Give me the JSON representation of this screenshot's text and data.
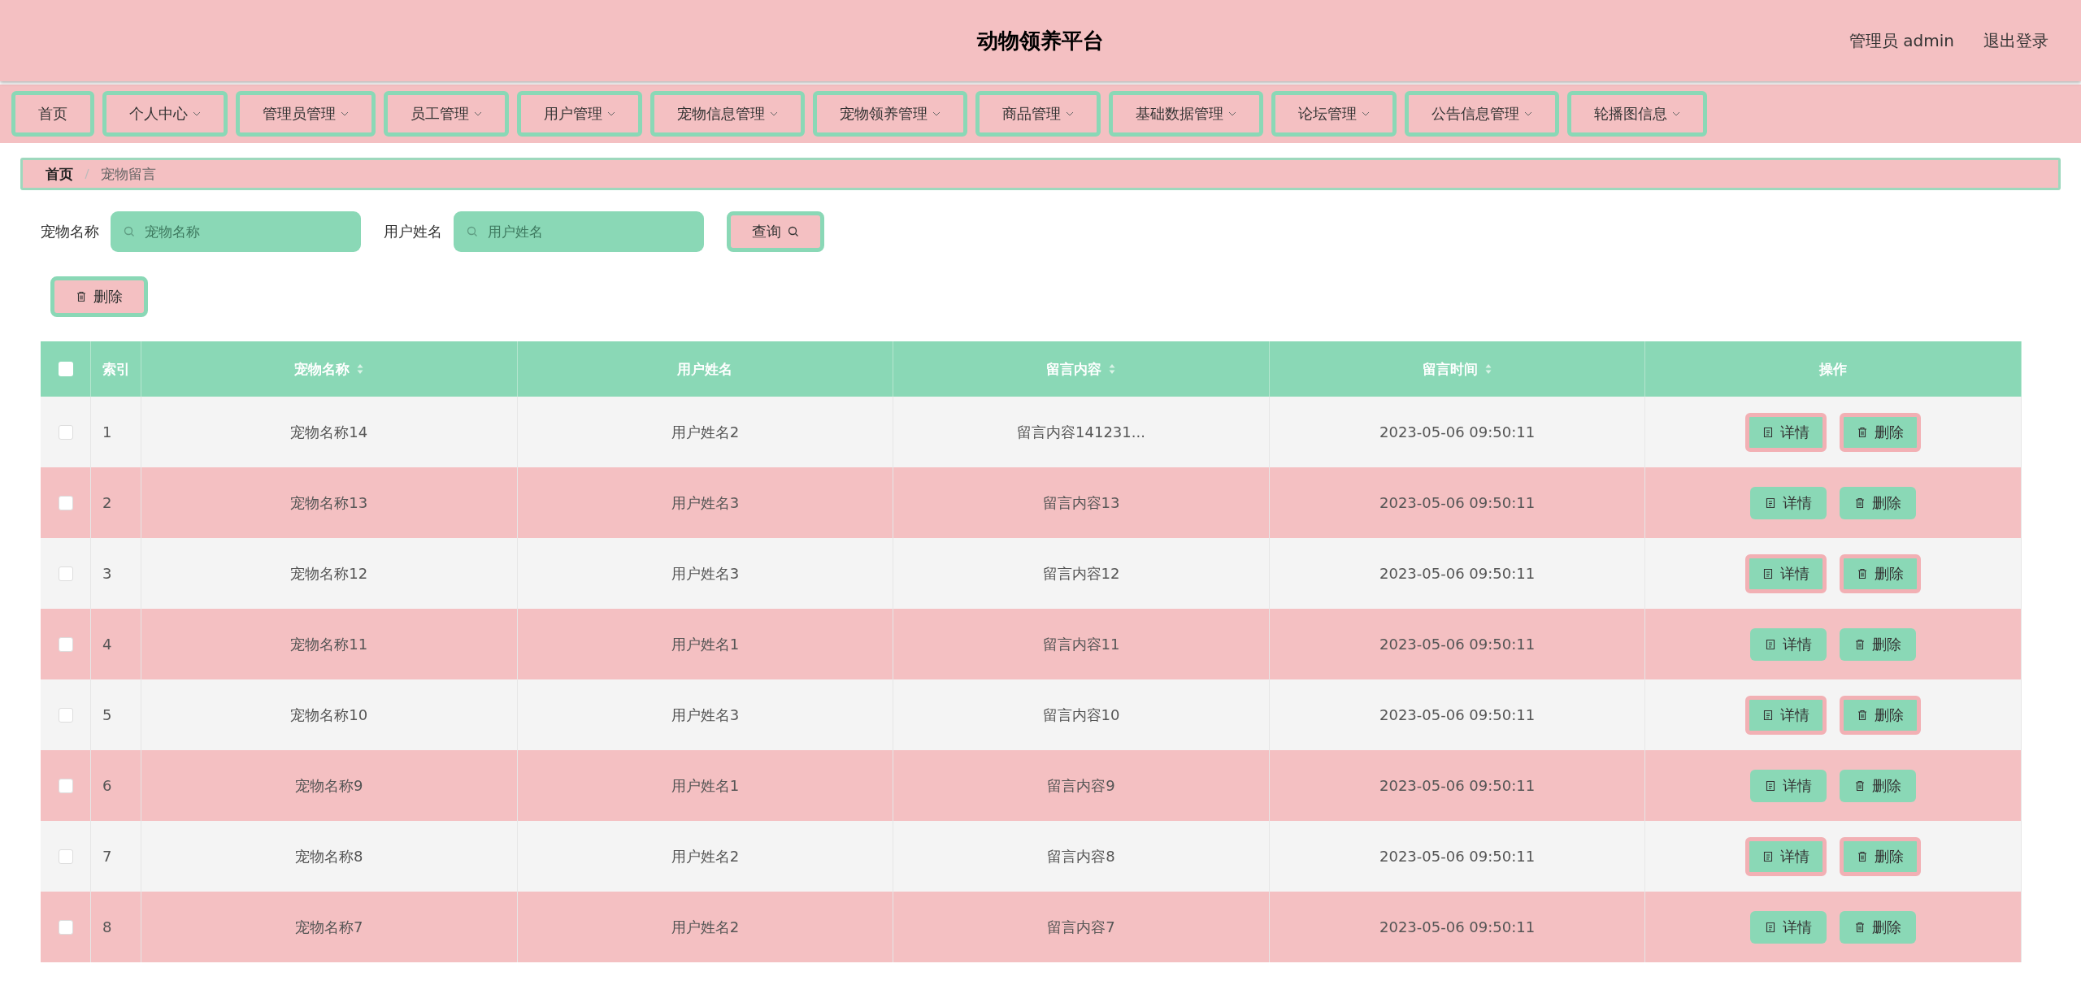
{
  "header": {
    "title": "动物领养平台",
    "user_label": "管理员 admin",
    "logout": "退出登录"
  },
  "nav": [
    {
      "label": "首页",
      "has_menu": false
    },
    {
      "label": "个人中心",
      "has_menu": true
    },
    {
      "label": "管理员管理",
      "has_menu": true
    },
    {
      "label": "员工管理",
      "has_menu": true
    },
    {
      "label": "用户管理",
      "has_menu": true
    },
    {
      "label": "宠物信息管理",
      "has_menu": true
    },
    {
      "label": "宠物领养管理",
      "has_menu": true
    },
    {
      "label": "商品管理",
      "has_menu": true
    },
    {
      "label": "基础数据管理",
      "has_menu": true
    },
    {
      "label": "论坛管理",
      "has_menu": true
    },
    {
      "label": "公告信息管理",
      "has_menu": true
    },
    {
      "label": "轮播图信息",
      "has_menu": true
    }
  ],
  "breadcrumb": [
    "首页",
    "宠物留言"
  ],
  "search": {
    "fields": [
      {
        "label": "宠物名称",
        "placeholder": "宠物名称"
      },
      {
        "label": "用户姓名",
        "placeholder": "用户姓名"
      }
    ],
    "query_button": "查询"
  },
  "delete_button": "删除",
  "table": {
    "select_all_checked": false,
    "columns": [
      {
        "label": "索引",
        "sortable": false
      },
      {
        "label": "宠物名称",
        "sortable": true
      },
      {
        "label": "用户姓名",
        "sortable": false
      },
      {
        "label": "留言内容",
        "sortable": true
      },
      {
        "label": "留言时间",
        "sortable": true
      },
      {
        "label": "操作",
        "sortable": false
      }
    ],
    "rows": [
      {
        "checked": false,
        "cells": [
          "1",
          "宠物名称14",
          "用户姓名2",
          "留言内容141231...",
          "2023-05-06 09:50:11"
        ],
        "actions": [
          "详情",
          "删除"
        ]
      },
      {
        "checked": false,
        "cells": [
          "2",
          "宠物名称13",
          "用户姓名3",
          "留言内容13",
          "2023-05-06 09:50:11"
        ],
        "actions": [
          "详情",
          "删除"
        ]
      },
      {
        "checked": false,
        "cells": [
          "3",
          "宠物名称12",
          "用户姓名3",
          "留言内容12",
          "2023-05-06 09:50:11"
        ],
        "actions": [
          "详情",
          "删除"
        ]
      },
      {
        "checked": false,
        "cells": [
          "4",
          "宠物名称11",
          "用户姓名1",
          "留言内容11",
          "2023-05-06 09:50:11"
        ],
        "actions": [
          "详情",
          "删除"
        ]
      },
      {
        "checked": false,
        "cells": [
          "5",
          "宠物名称10",
          "用户姓名3",
          "留言内容10",
          "2023-05-06 09:50:11"
        ],
        "actions": [
          "详情",
          "删除"
        ]
      },
      {
        "checked": false,
        "cells": [
          "6",
          "宠物名称9",
          "用户姓名1",
          "留言内容9",
          "2023-05-06 09:50:11"
        ],
        "actions": [
          "详情",
          "删除"
        ]
      },
      {
        "checked": false,
        "cells": [
          "7",
          "宠物名称8",
          "用户姓名2",
          "留言内容8",
          "2023-05-06 09:50:11"
        ],
        "actions": [
          "详情",
          "删除"
        ]
      },
      {
        "checked": false,
        "cells": [
          "8",
          "宠物名称7",
          "用户姓名2",
          "留言内容7",
          "2023-05-06 09:50:11"
        ],
        "actions": [
          "详情",
          "删除"
        ]
      }
    ]
  }
}
